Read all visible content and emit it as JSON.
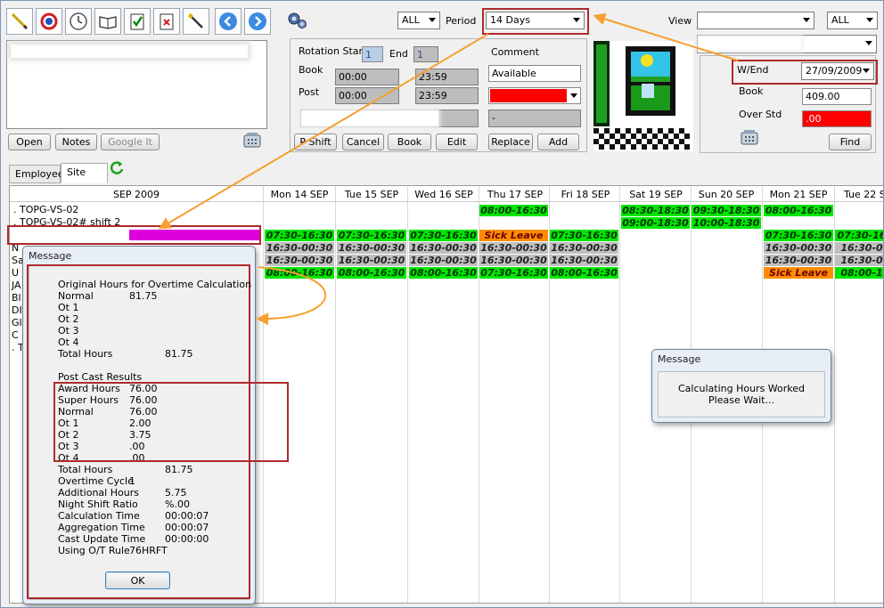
{
  "toolbar": {
    "icons": [
      "pencil-icon",
      "q-icon",
      "clock-icon",
      "book-icon",
      "checklist-icon",
      "document-red-x-icon",
      "wand-icon",
      "back-arrow-icon",
      "forward-arrow-icon"
    ]
  },
  "header": {
    "filter_all_1": "ALL",
    "period_label": "Period",
    "period_value": "14 Days",
    "view_label": "View",
    "view_value": "",
    "filter_all_2": "ALL"
  },
  "left_panel": {
    "open": "Open",
    "notes": "Notes",
    "google_it": "Google It"
  },
  "rotation": {
    "rotation_start_label": "Rotation Start",
    "rotation_start_value": "1",
    "end_label": "End",
    "end_value": "1",
    "book_label": "Book",
    "book_from": "00:00",
    "book_to": "23:59",
    "post_label": "Post",
    "post_from": "00:00",
    "post_to": "23:59",
    "comment_label": "Comment",
    "comment_value": "Available",
    "dash_value": "-",
    "buttons": {
      "shift": "P Shift",
      "cancel": "Cancel",
      "book": "Book",
      "edit": "Edit",
      "replace": "Replace",
      "add": "Add"
    }
  },
  "right_panel": {
    "wend_label": "W/End",
    "wend_value": "27/09/2009",
    "book_label": "Book",
    "book_value": "409.00",
    "over_std_label": "Over Std",
    "over_std_value": ".00",
    "find": "Find"
  },
  "tabs": {
    "employee": "Employee",
    "site": "Site"
  },
  "grid": {
    "month_header": "SEP 2009",
    "days": [
      "Mon 14 SEP",
      "Tue 15 SEP",
      "Wed 16 SEP",
      "Thu 17 SEP",
      "Fri 18 SEP",
      "Sat 19 SEP",
      "Sun 20 SEP",
      "Mon 21 SEP",
      "Tue 22 S"
    ],
    "rows": [
      ". TOPG-VS-02",
      ". TOPG-VS-02# shift 2",
      "",
      "N",
      "Sa",
      "U",
      "JA",
      "Bl",
      "DI",
      "Gl",
      "C",
      ". T"
    ],
    "shifts": {
      "r0_thu": "08:00-16:30",
      "r0_sat": "08:30-18:30",
      "r0_sun": "09:30-18:30",
      "r0_mon21": "08:00-16:30",
      "r1_sat": "09:00-18:30",
      "r1_sun": "10:00-18:30",
      "r2": [
        "07:30-16:30",
        "07:30-16:30",
        "07:30-16:30",
        "Sick Leave",
        "07:30-16:30",
        "",
        "",
        "07:30-16:30",
        "07:30-16"
      ],
      "r3": [
        "16:30-00:30",
        "16:30-00:30",
        "16:30-00:30",
        "16:30-00:30",
        "16:30-00:30",
        "",
        "",
        "16:30-00:30",
        "16:30-0"
      ],
      "r4": [
        "16:30-00:30",
        "16:30-00:30",
        "16:30-00:30",
        "16:30-00:30",
        "16:30-00:30",
        "",
        "",
        "16:30-00:30",
        "16:30-0"
      ],
      "r5": [
        "08:00-16:30",
        "08:00-16:30",
        "08:00-16:30",
        "07:30-16:30",
        "08:00-16:30",
        "",
        "",
        "Sick Leave",
        "08:00-1"
      ]
    }
  },
  "message_dialog": {
    "title": "Message",
    "lines": [
      "Original Hours for Overtime Calculation",
      "Normal",
      "81.75",
      "Ot 1",
      "Ot 2",
      "Ot 3",
      "Ot 4",
      "Total Hours",
      "81.75",
      "Post Cast Results",
      "Award Hours",
      "76.00",
      "Super Hours",
      "76.00",
      "Normal",
      "76.00",
      "Ot 1",
      "2.00",
      "Ot 2",
      "3.75",
      "Ot 3",
      ".00",
      "Ot 4",
      ".00",
      "Total Hours",
      "81.75",
      "Overtime Cycle",
      "1",
      "Additional Hours",
      "5.75",
      "Night Shift Ratio",
      "%.00",
      "Calculation Time",
      "00:00:07",
      "Aggregation Time",
      "00:00:07",
      "Cast Update Time",
      "00:00:00",
      "Using O/T Rule",
      "76HRFT"
    ],
    "ok": "OK"
  },
  "wait_dialog": {
    "title": "Message",
    "line1": "Calculating Hours Worked",
    "line2": "Please Wait..."
  },
  "colors": {
    "annotation_red": "#b02a2a",
    "arrow_orange": "#f5a030",
    "shift_green": "#00e600",
    "shift_orange": "#ff8c00",
    "magenta": "#dd00dd"
  }
}
